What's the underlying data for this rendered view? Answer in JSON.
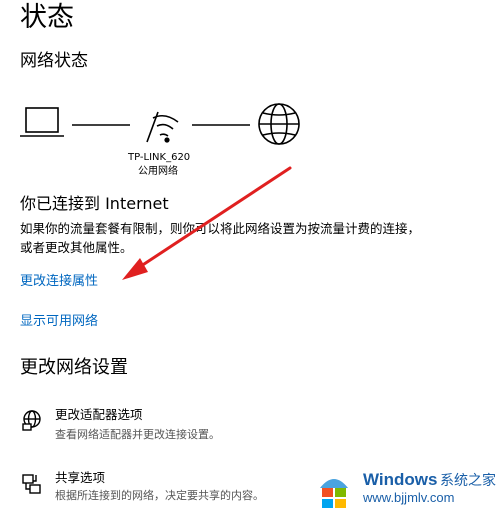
{
  "header": {
    "title": "状态"
  },
  "network_status": {
    "heading": "网络状态",
    "network_name": "TP-LINK_620",
    "network_type": "公用网络",
    "icons": [
      "laptop-icon",
      "wifi-icon",
      "globe-icon"
    ]
  },
  "connection": {
    "heading": "你已连接到 Internet",
    "description": "如果你的流量套餐有限制，则你可以将此网络设置为按流量计费的连接，或者更改其他属性。"
  },
  "links": {
    "change_properties": "更改连接属性",
    "show_networks": "显示可用网络"
  },
  "change_settings": {
    "heading": "更改网络设置",
    "items": [
      {
        "icon": "adapter-icon",
        "title": "更改适配器选项",
        "desc": "查看网络适配器并更改连接设置。"
      },
      {
        "icon": "sharing-icon",
        "title": "共享选项",
        "desc": "根据所连接到的网络，决定要共享的内容。"
      }
    ]
  },
  "watermark": {
    "brand": "Windows",
    "brand_cn": "系统之家",
    "url": "www.bjjmlv.com"
  },
  "colors": {
    "accent": "#0067c0",
    "arrow": "#e02020"
  }
}
